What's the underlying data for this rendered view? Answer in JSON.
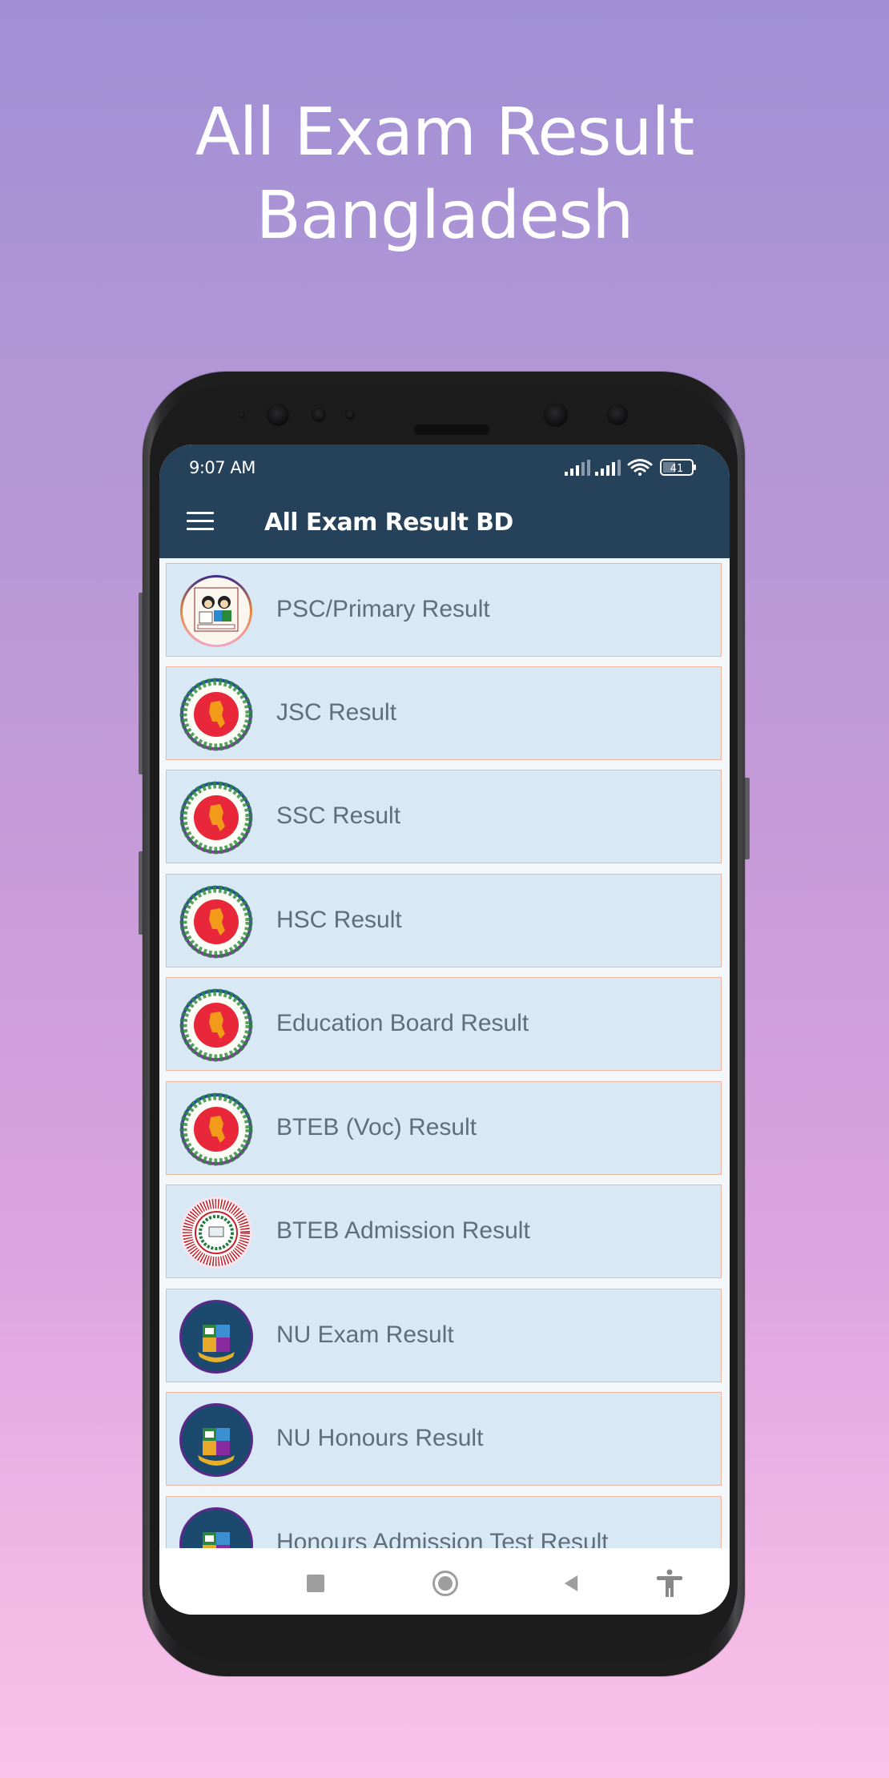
{
  "promo": {
    "headline_line1": "All Exam Result",
    "headline_line2": "Bangladesh"
  },
  "status_bar": {
    "time": "9:07 AM",
    "battery_level": "41",
    "icons": [
      "signal-icon",
      "signal-icon",
      "wifi-icon",
      "battery-icon"
    ]
  },
  "app_bar": {
    "menu_icon": "hamburger-menu-icon",
    "title": "All Exam Result BD"
  },
  "list": {
    "items": [
      {
        "label": "PSC/Primary Result",
        "icon": "primary-education-logo"
      },
      {
        "label": "JSC Result",
        "icon": "bangladesh-govt-seal"
      },
      {
        "label": "SSC Result",
        "icon": "bangladesh-govt-seal"
      },
      {
        "label": "HSC Result",
        "icon": "bangladesh-govt-seal"
      },
      {
        "label": "Education Board Result",
        "icon": "bangladesh-govt-seal"
      },
      {
        "label": "BTEB (Voc) Result",
        "icon": "bangladesh-govt-seal"
      },
      {
        "label": "BTEB Admission Result",
        "icon": "bteb-logo"
      },
      {
        "label": "NU Exam Result",
        "icon": "national-university-logo"
      },
      {
        "label": "NU Honours Result",
        "icon": "national-university-logo"
      },
      {
        "label": "Honours Admission Test Result",
        "icon": "national-university-logo"
      }
    ]
  },
  "nav_bar": {
    "buttons": [
      "recents",
      "home",
      "back",
      "accessibility"
    ]
  },
  "colors": {
    "app_bar": "#26415a",
    "item_background": "#d8e9f5",
    "item_border": "#f0b6a4",
    "item_text": "#5f6e78",
    "background_top": "#9f8fd4",
    "background_bottom": "#f8c2ea"
  }
}
